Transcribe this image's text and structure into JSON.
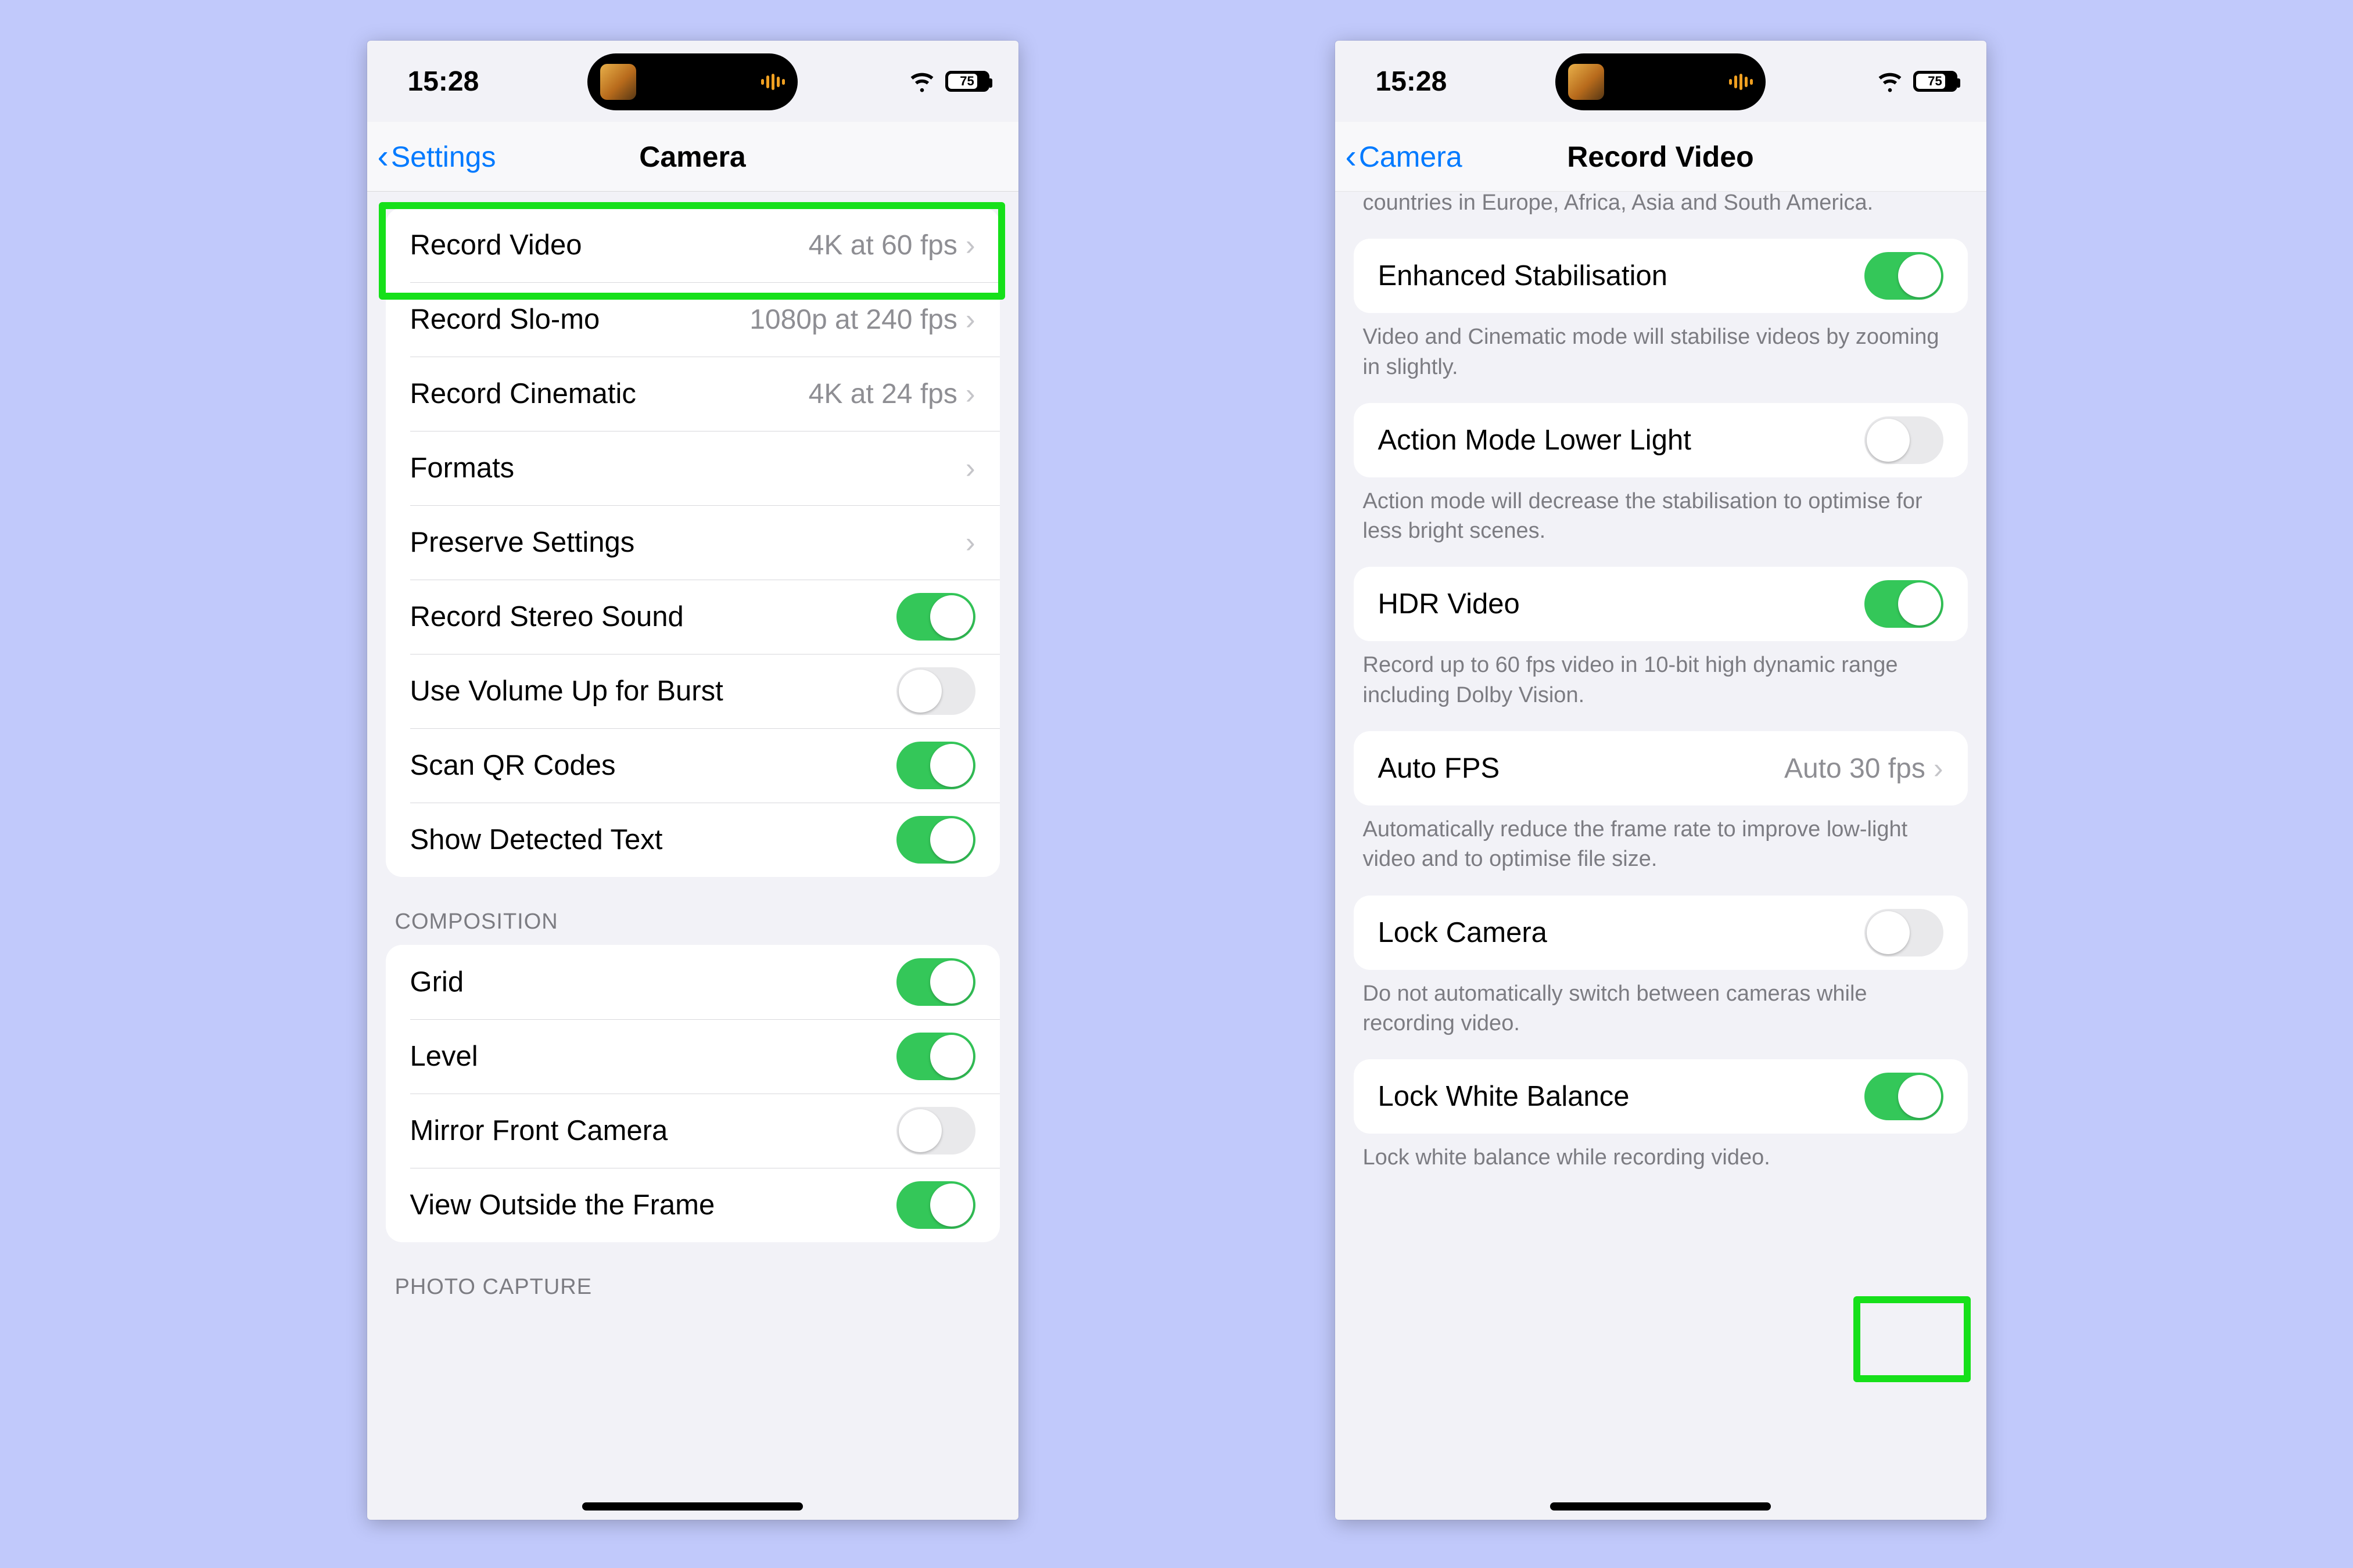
{
  "status": {
    "time": "15:28",
    "battery_pct": "75",
    "battery_fill_pct": 75
  },
  "phone1": {
    "nav_back": "Settings",
    "nav_title": "Camera",
    "rows": {
      "record_video": {
        "label": "Record Video",
        "detail": "4K at 60 fps"
      },
      "record_slomo": {
        "label": "Record Slo-mo",
        "detail": "1080p at 240 fps"
      },
      "record_cinematic": {
        "label": "Record Cinematic",
        "detail": "4K at 24 fps"
      },
      "formats": {
        "label": "Formats"
      },
      "preserve": {
        "label": "Preserve Settings"
      },
      "stereo": {
        "label": "Record Stereo Sound",
        "on": true
      },
      "vol_burst": {
        "label": "Use Volume Up for Burst",
        "on": false
      },
      "qr": {
        "label": "Scan QR Codes",
        "on": true
      },
      "detected_text": {
        "label": "Show Detected Text",
        "on": true
      }
    },
    "headers": {
      "composition": "COMPOSITION",
      "photo_capture": "PHOTO CAPTURE"
    },
    "composition": {
      "grid": {
        "label": "Grid",
        "on": true
      },
      "level": {
        "label": "Level",
        "on": true
      },
      "mirror": {
        "label": "Mirror Front Camera",
        "on": false
      },
      "view_outside": {
        "label": "View Outside the Frame",
        "on": true
      }
    }
  },
  "phone2": {
    "nav_back": "Camera",
    "nav_title": "Record Video",
    "clipped_footer": "countries in Europe, Africa, Asia and South America.",
    "enh_stab": {
      "label": "Enhanced Stabilisation",
      "on": true,
      "foot": "Video and Cinematic mode will stabilise videos by zooming in slightly."
    },
    "action_mode": {
      "label": "Action Mode Lower Light",
      "on": false,
      "foot": "Action mode will decrease the stabilisation to optimise for less bright scenes."
    },
    "hdr": {
      "label": "HDR Video",
      "on": true,
      "foot": "Record up to 60 fps video in 10-bit high dynamic range including Dolby Vision."
    },
    "autofps": {
      "label": "Auto FPS",
      "detail": "Auto 30 fps",
      "foot": "Automatically reduce the frame rate to improve low-light video and to optimise file size."
    },
    "lock_cam": {
      "label": "Lock Camera",
      "on": false,
      "foot": "Do not automatically switch between cameras while recording video."
    },
    "lock_wb": {
      "label": "Lock White Balance",
      "on": true,
      "foot": "Lock white balance while recording video."
    }
  }
}
